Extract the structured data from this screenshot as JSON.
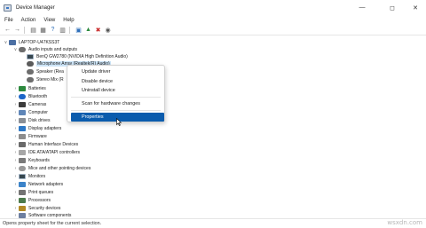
{
  "window": {
    "title": "Device Manager"
  },
  "menu": [
    "File",
    "Action",
    "View",
    "Help"
  ],
  "tree": {
    "root": "LAPTOP-U47KSS3T",
    "audio_group": "Audio inputs and outputs",
    "audio_children": [
      "BenQ GW2780 (NVIDIA High Definition Audio)",
      "Microphone Array (Realtek(R) Audio)",
      "Speaker (Rea",
      "Stereo Mix (R"
    ],
    "categories": [
      "Batteries",
      "Bluetooth",
      "Cameras",
      "Computer",
      "Disk drives",
      "Display adapters",
      "Firmware",
      "Human Interface Devices",
      "IDE ATA/ATAPI controllers",
      "Keyboards",
      "Mice and other pointing devices",
      "Monitors",
      "Network adapters",
      "Print queues",
      "Processors",
      "Security devices",
      "Software components"
    ]
  },
  "context_menu": {
    "items": [
      "Update driver",
      "Disable device",
      "Uninstall device",
      "Scan for hardware changes",
      "Properties"
    ]
  },
  "status_text": "Opens property sheet for the current selection.",
  "watermark": "wsxdn.com",
  "colors": {
    "selection": "#cce4f7",
    "menu_highlight": "#0b5cad"
  }
}
